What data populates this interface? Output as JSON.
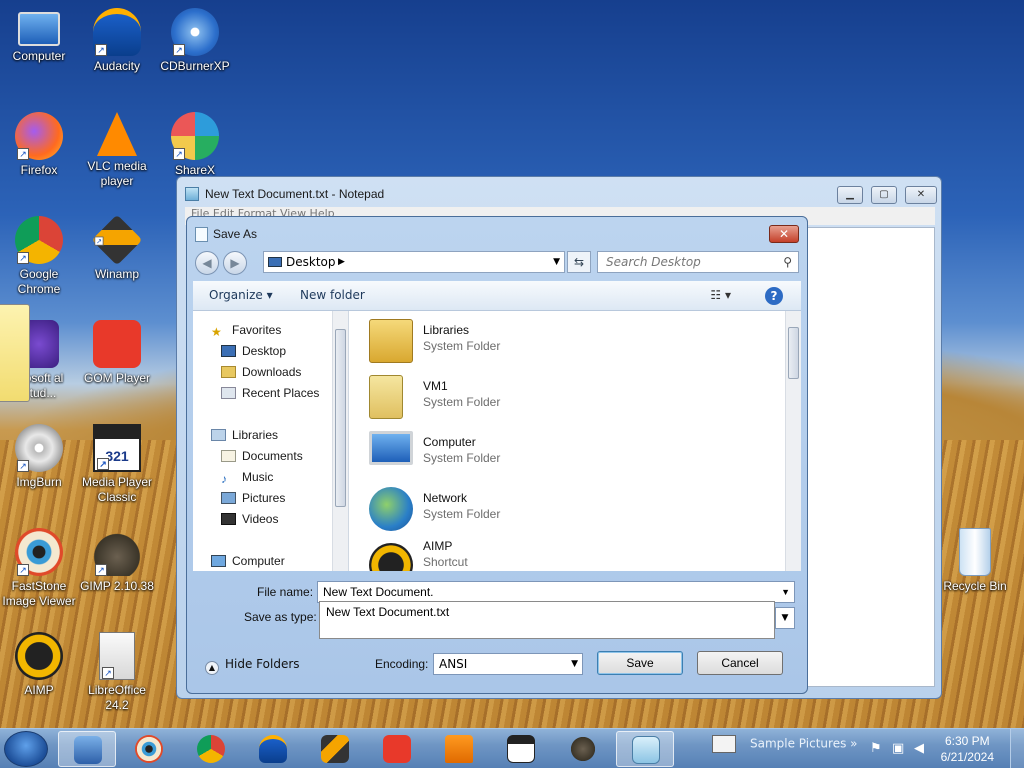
{
  "desktop": {
    "icons": [
      {
        "label": "Computer"
      },
      {
        "label": "Audacity"
      },
      {
        "label": "CDBurnerXP"
      },
      {
        "label": "Firefox"
      },
      {
        "label": "VLC media player"
      },
      {
        "label": "ShareX"
      },
      {
        "label": "Google Chrome"
      },
      {
        "label": "Winamp"
      },
      {
        "label": "crosoft al Stud..."
      },
      {
        "label": "GOM Player"
      },
      {
        "label": "ImgBurn"
      },
      {
        "label": "Media Player Classic"
      },
      {
        "label": "FastStone Image Viewer"
      },
      {
        "label": "GIMP 2.10.38"
      },
      {
        "label": "AIMP"
      },
      {
        "label": "LibreOffice 24.2"
      },
      {
        "label": "Recycle Bin"
      }
    ]
  },
  "notepad": {
    "title": "New Text Document.txt - Notepad",
    "menu": "File   Edit   Format   View   Help"
  },
  "dialog": {
    "title": "Save As",
    "close_label": "✕",
    "address": "Desktop",
    "search_placeholder": "Search Desktop",
    "toolbar": {
      "organize": "Organize ▾",
      "new_folder": "New folder",
      "help": "?"
    },
    "nav": {
      "favorites": "Favorites",
      "desktop": "Desktop",
      "downloads": "Downloads",
      "recent": "Recent Places",
      "libraries": "Libraries",
      "documents": "Documents",
      "music": "Music",
      "pictures": "Pictures",
      "videos": "Videos",
      "computer": "Computer"
    },
    "items": [
      {
        "name": "Libraries",
        "type": "System Folder"
      },
      {
        "name": "VM1",
        "type": "System Folder"
      },
      {
        "name": "Computer",
        "type": "System Folder"
      },
      {
        "name": "Network",
        "type": "System Folder"
      },
      {
        "name": "AIMP",
        "type": "Shortcut"
      }
    ],
    "file_name_label": "File name:",
    "file_name_value": "New Text Document.",
    "save_as_type_label": "Save as type:",
    "autocomplete": "New Text Document.txt",
    "hide_folders": "Hide Folders",
    "encoding_label": "Encoding:",
    "encoding_value": "ANSI",
    "save": "Save",
    "cancel": "Cancel"
  },
  "taskbar": {
    "toolbar_label": "Sample Pictures",
    "time": "6:30 PM",
    "date": "6/21/2024"
  }
}
